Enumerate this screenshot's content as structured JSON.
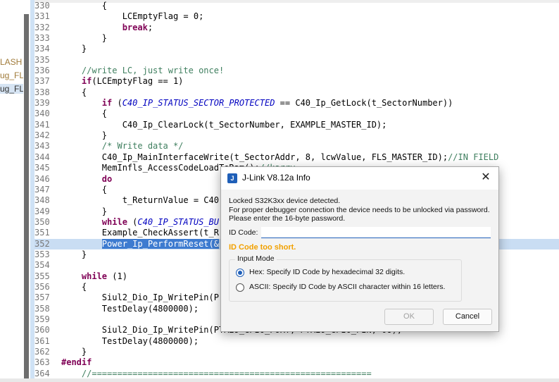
{
  "left_panel": {
    "items": [
      {
        "label": "LASH",
        "selected": false
      },
      {
        "label": "ug_FL/",
        "selected": false
      },
      {
        "label": "ug_FL/",
        "selected": true
      }
    ]
  },
  "editor": {
    "lines": [
      {
        "n": "330",
        "t": "        {"
      },
      {
        "n": "331",
        "t": "            LCEmptyFlag = 0;"
      },
      {
        "n": "332",
        "t": "            <span class=\"kw\">break</span>;"
      },
      {
        "n": "333",
        "t": "        }"
      },
      {
        "n": "334",
        "t": "    }"
      },
      {
        "n": "335",
        "t": ""
      },
      {
        "n": "336",
        "t": "    <span class=\"cm\">//write LC, just write once!</span>"
      },
      {
        "n": "337",
        "t": "    <span class=\"kw\">if</span>(LCEmptyFlag == 1)"
      },
      {
        "n": "338",
        "t": "    {"
      },
      {
        "n": "339",
        "t": "        <span class=\"kw\">if</span> (<span class=\"mac\">C40_IP_STATUS_SECTOR_PROTECTED</span> == C40_Ip_GetLock(t_SectorNumber))"
      },
      {
        "n": "340",
        "t": "        {"
      },
      {
        "n": "341",
        "t": "            C40_Ip_ClearLock(t_SectorNumber, EXAMPLE_MASTER_ID);"
      },
      {
        "n": "342",
        "t": "        }"
      },
      {
        "n": "343",
        "t": "        <span class=\"cm\">/* Write data */</span>"
      },
      {
        "n": "344",
        "t": "        C40_Ip_MainInterfaceWrite(t_SectorAddr, 8, lcwValue, FLS_MASTER_ID);<span class=\"cm\">//IN FIELD</span>"
      },
      {
        "n": "345",
        "t": "        MemInfls_AccessCodeLoadToRam();<span class=\"cm\">//karry</span>"
      },
      {
        "n": "346",
        "t": "        <span class=\"kw\">do</span>"
      },
      {
        "n": "347",
        "t": "        {"
      },
      {
        "n": "348",
        "t": "            t_ReturnValue = C40"
      },
      {
        "n": "349",
        "t": "        }"
      },
      {
        "n": "350",
        "t": "        <span class=\"kw\">while</span> (<span class=\"mac\">C40_IP_STATUS_BU</span>"
      },
      {
        "n": "351",
        "t": "        Example_CheckAssert(t_R"
      },
      {
        "n": "352",
        "t": "        <span class=\"sel\">Power_Ip_PerformReset(&amp;</span>",
        "hl": true
      },
      {
        "n": "353",
        "t": "    }"
      },
      {
        "n": "354",
        "t": ""
      },
      {
        "n": "355",
        "t": "    <span class=\"kw\">while</span> (1)"
      },
      {
        "n": "356",
        "t": "    {"
      },
      {
        "n": "357",
        "t": "        Siul2_Dio_Ip_WritePin(P"
      },
      {
        "n": "358",
        "t": "        TestDelay(4800000);"
      },
      {
        "n": "359",
        "t": ""
      },
      {
        "n": "360",
        "t": "        Siul2_Dio_Ip_WritePin(PTA29_GPIO_PORT, PTA29_GPIO_PIN, 0U);"
      },
      {
        "n": "361",
        "t": "        TestDelay(4800000);"
      },
      {
        "n": "362",
        "t": "    }"
      },
      {
        "n": "363",
        "t": "<span class=\"pp\">#endif</span>"
      },
      {
        "n": "364",
        "t": "    <span class=\"cm\">//=======================================================</span>"
      }
    ]
  },
  "dialog": {
    "title": "J-Link V8.12a Info",
    "icon": "jlink-icon",
    "close_glyph": "✕",
    "message_lines": [
      "Locked S32K3xx device detected.",
      "For proper debugger connection the device needs to be unlocked via password.",
      "Please enter the 16-byte password."
    ],
    "id_code_label": "ID Code:",
    "id_code_value": "",
    "error_text": "ID Code too short.",
    "input_mode_title": "Input Mode",
    "hex_option": "Hex: Specify ID Code by hexadecimal 32 digits.",
    "ascii_option": "ASCII: Specify ID Code by ASCII character within 16 letters.",
    "selected_mode": "hex",
    "ok_label": "OK",
    "cancel_label": "Cancel"
  },
  "colors": {
    "keyword": "#7f0055",
    "comment": "#3f7f5f",
    "macro": "#0000c0",
    "selection": "#3d7bd0",
    "error": "#f2a100",
    "accent": "#1f5fb8"
  }
}
